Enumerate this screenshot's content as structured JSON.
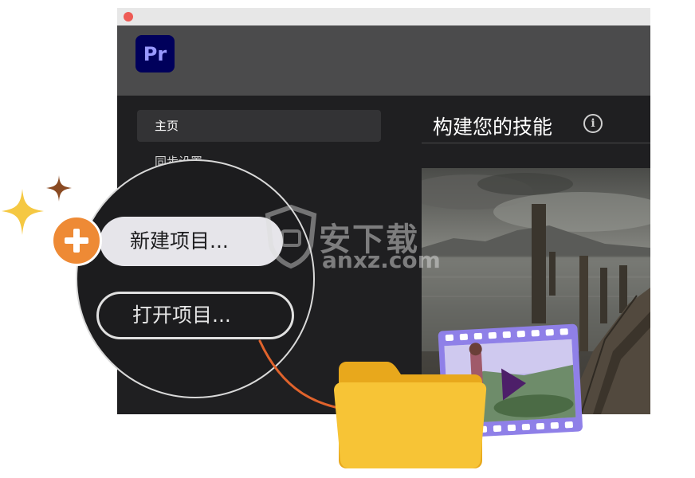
{
  "app": {
    "logo_text": "Pr"
  },
  "sidebar": {
    "items": [
      {
        "label": "主页"
      },
      {
        "label": "同步设置"
      }
    ]
  },
  "main": {
    "section_title": "构建您的技能"
  },
  "callout": {
    "new_project_label": "新建项目...",
    "open_project_label": "打开项目..."
  },
  "watermark": {
    "cn": "安下载",
    "en": "anxz.com"
  },
  "colors": {
    "brand_bg": "#00005b",
    "brand_text": "#9999ff",
    "accent_orange": "#ee8a35",
    "folder_yellow": "#f7c436",
    "film_purple": "#8f80e8"
  }
}
